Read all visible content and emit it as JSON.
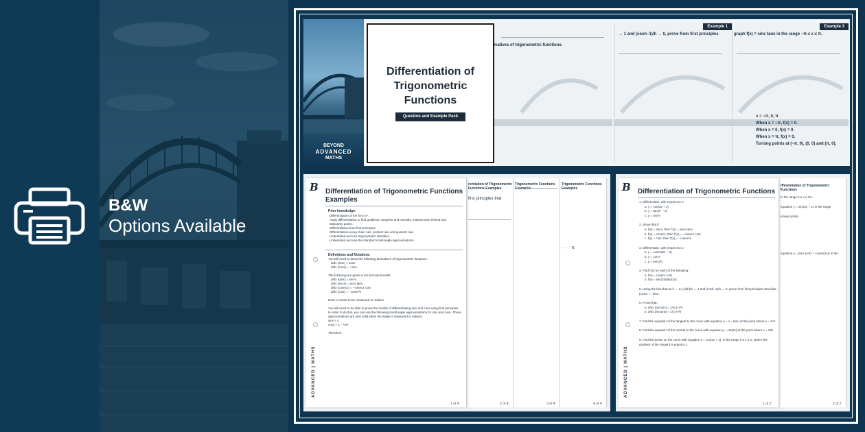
{
  "banner": {
    "bw_title": "B&W",
    "bw_subtitle": "Options Available"
  },
  "cover": {
    "title_line1": "Differentiation of",
    "title_line2": "Trigonometric",
    "title_line3": "Functions",
    "pill": "Question and Example Pack",
    "brand_line1": "BEYOND",
    "brand_line2": "ADVANCED",
    "brand_line3": "MATHS"
  },
  "top_pages": {
    "page2_text": "derivatives of trigonometric functions.",
    "page3_tag": "Example 1",
    "page3_text": "→ 1 and (cosh−1)/h → 0, prove from first principles",
    "page4_tag": "Example 3",
    "page4_text": "graph f(x) = sinx tanx in the range −π ≤ x ≤ π.",
    "page4_sol1": "x = −π, 0, π",
    "page4_sol2": "When x = −π, f(x) = 0.",
    "page4_sol3": "When x = 0, f(x) = 0.",
    "page4_sol4": "When x = π, f(x) = 0.",
    "page4_sol5": "Turning points at (−π, 0), (0, 0) and (π, 0)."
  },
  "examples_doc": {
    "title_line1": "Differentiation of Trigonometric Functions",
    "title_line2": "Examples",
    "prior_heading": "Prior knowledge:",
    "prior_items": [
      "Differentiation of the form xⁿ.",
      "Apply differentiation to find gradients, tangents and normals, maxima and minima and stationary points.",
      "Differentiation from first principles.",
      "Differentiation using chain rule, product rule and quotient rule.",
      "Understand and use trigonometric identities.",
      "Understand and use the standard small angle approximations."
    ],
    "defs_heading": "Definitions and Notations",
    "defs_intro": "You will need to know the following derivatives of trigonometric functions.",
    "defs_1": "d/dx (sinx) = cosx",
    "defs_2": "d/dx (cosx) = −sinx",
    "formula_intro": "The following are given in the formula booklet:",
    "formula_1": "d/dx (tanx) = sec²x",
    "formula_2": "d/dx (secx) = secx tanx",
    "formula_3": "d/dx (cosecx) = −cosecx cotx",
    "formula_4": "d/dx (cotx) = −cosec²x",
    "note": "Note: x needs to be measured in radians.",
    "para": "You will need to be able to prove the results of differentiating sinx and cosx using first principles. In order to do this, you can use the following small angle approximations for sinx and cosx. These approximations are only valid when the angle is measured in radians.",
    "approx_1": "sinx ≈ x",
    "approx_2": "cosx ≈ 1 − ½x²",
    "therefore": "Therefore,",
    "page_no": "1 of 4",
    "side_brand": "ADVANCED | MATHS",
    "tab_header": "rentiation of Trigonometric Functions Examples",
    "tab_header2": "Trigonometric Functions Examples",
    "tab_header3": "Trigonometric Functions Examples",
    "tab_text": "first principles that",
    "page_no2": "2 of 4",
    "page_no3": "3 of 4",
    "page_no4": "4 of 4"
  },
  "questions_doc": {
    "title": "Differentiation of Trigonometric Functions",
    "q1": "1.   Differentiate, with respect to x:",
    "q1a": "a.   y = cos(3x + 1)",
    "q1b": "b.   y = tan(x² − 2)",
    "q1c": "c.   y = sec²x",
    "q2": "2.   Show that if:",
    "q2a": "a.   f(x) = secx, then f′(x) = secx tanx",
    "q2b": "b.   f(x) = cosecx, then f′(x) = −cosecx cotx",
    "q2c": "c.   f(x) = cotx, then f′(x) = −cosec²x",
    "q3": "3.   Differentiate, with respect to x:",
    "q3a": "a.   y = cosec(2x − 3)",
    "q3b": "b.   y = cot⁴x",
    "q3c": "c.   y = sec(x²)",
    "q4": "4.   Find f′(x) for each of the following:",
    "q4a": "a.   f(x) = cosecx cotx",
    "q4b": "b.   f(x) = sec(2x)/tan(2x)",
    "q5": "5.   Using the fact that as h → 0, (sinh)/h → 1 and (cosh−1)/h → 0, prove from first principles that d/dx (cosx) = −sinx.",
    "q6": "6.   Prove that:",
    "q6a": "a.   d/dx (arcsinx) = 1/√(1−x²)",
    "q6b": "b.   d/dx (arctanx) = 1/(1+x²)",
    "q7": "7.   Find the equation of the tangent to the curve with equation y = x − tanx at the point where x = π/4",
    "q8": "8.   Find the equation of the normal to the curve with equation y = cot(2x) at the point where x = π/8",
    "q9": "9.   Find the points on the curve with equation y = cos(2x + 1), in the range 0 ≤ x ≤ π, where the gradient of the tangent is equal to 1.",
    "page_no": "1 of 2",
    "page_no2": "2 of 2",
    "side_brand": "ADVANCED | MATHS",
    "tab_header": "ifferentiation of Trigonometric Functions",
    "tab_text1": "in the range 0 ≤ x ≤ 2π.",
    "tab_text2": "equation y = sin(2x) + 1) in the range",
    "tab_text3": "ionary points.",
    "tab_text4": "equation y = tanx (cotx + cosec(2x)) in the"
  }
}
